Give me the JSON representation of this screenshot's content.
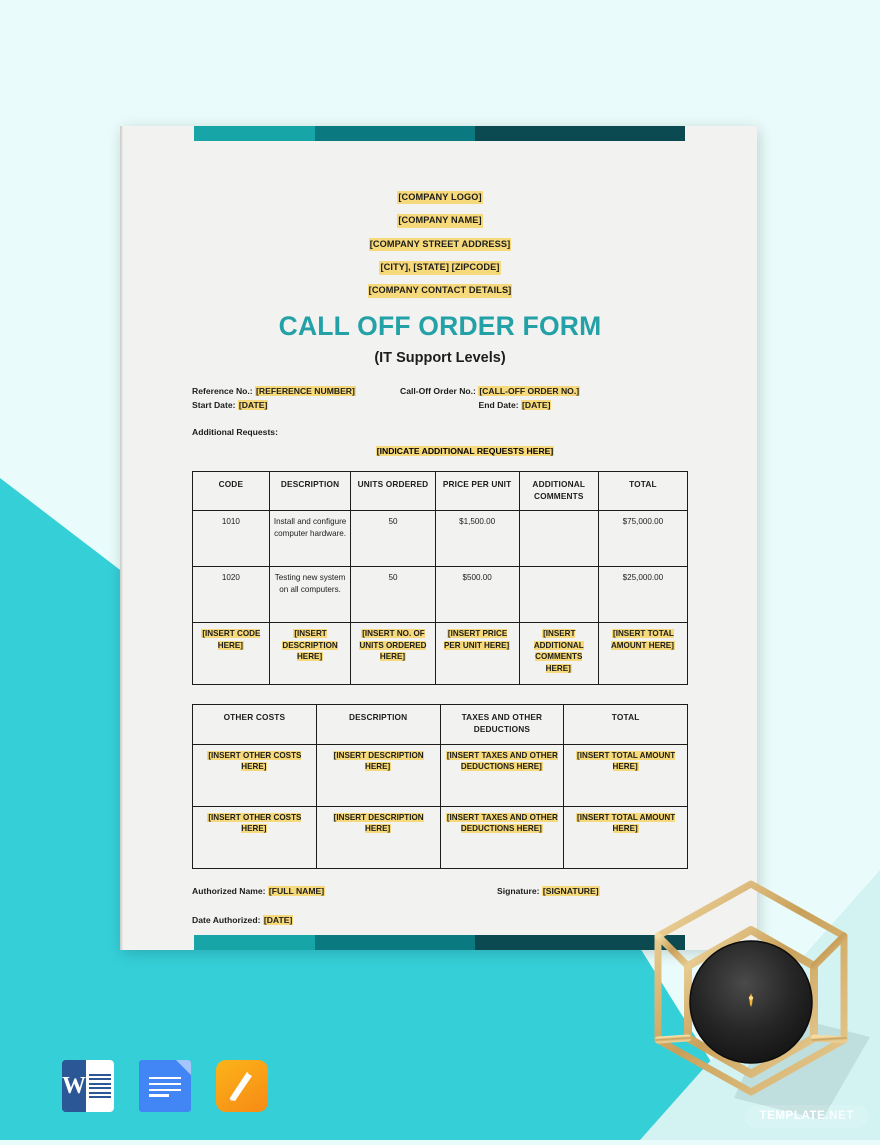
{
  "background": {
    "pale_teal": "#e9fcfb",
    "cyan": "#35cfd8",
    "page": "#f2f2f1"
  },
  "page": {
    "band_colors": [
      "#17a5a8",
      "#0b7a80",
      "#0b4a51"
    ],
    "company": [
      "[COMPANY LOGO]",
      "[COMPANY NAME]",
      "[COMPANY STREET ADDRESS]",
      "[CITY], [STATE] [ZIPCODE]",
      "[COMPANY CONTACT DETAILS]"
    ],
    "title": "CALL OFF ORDER FORM",
    "title_color": "#23a1a6",
    "subtitle": "(IT Support Levels)",
    "highlight_color": "#f6d97a",
    "meta": {
      "reference_label": "Reference No.: ",
      "reference_value": "[REFERENCE NUMBER]",
      "calloff_label": "Call-Off Order No.: ",
      "calloff_value": "[CALL-OFF ORDER NO.]",
      "start_label": "Start Date: ",
      "start_value": "[DATE]",
      "end_label": "End Date: ",
      "end_value": "[DATE]",
      "additional_label": "Additional Requests:",
      "additional_value": "[INDICATE ADDITIONAL REQUESTS HERE]"
    },
    "order_table": {
      "headers": [
        "CODE",
        "DESCRIPTION",
        "UNITS ORDERED",
        "PRICE PER UNIT",
        "ADDITIONAL COMMENTS",
        "TOTAL"
      ],
      "rows": [
        {
          "code": "1010",
          "description": "Install and configure computer hardware.",
          "units": "50",
          "price": "$1,500.00",
          "comments": "",
          "total": "$75,000.00",
          "highlight": false
        },
        {
          "code": "1020",
          "description": "Testing new system on all computers.",
          "units": "50",
          "price": "$500.00",
          "comments": "",
          "total": "$25,000.00",
          "highlight": false
        },
        {
          "code": "[INSERT CODE HERE]",
          "description": "[INSERT DESCRIPTION HERE]",
          "units": "[INSERT NO. OF UNITS ORDERED HERE]",
          "price": "[INSERT PRICE PER UNIT HERE]",
          "comments": "[INSERT ADDITIONAL COMMENTS HERE]",
          "total": "[INSERT TOTAL AMOUNT HERE]",
          "highlight": true
        }
      ]
    },
    "costs_table": {
      "headers": [
        "OTHER COSTS",
        "DESCRIPTION",
        "TAXES AND OTHER DEDUCTIONS",
        "TOTAL"
      ],
      "rows": [
        {
          "other_costs": "[INSERT OTHER COSTS HERE]",
          "description": "[INSERT DESCRIPTION HERE]",
          "taxes": "[INSERT TAXES AND OTHER DEDUCTIONS HERE]",
          "total": "[INSERT TOTAL AMOUNT HERE]"
        },
        {
          "other_costs": "[INSERT OTHER COSTS HERE]",
          "description": "[INSERT DESCRIPTION HERE]",
          "taxes": "[INSERT TAXES AND OTHER DEDUCTIONS HERE]",
          "total": "[INSERT TOTAL AMOUNT HERE]"
        }
      ]
    },
    "footer": {
      "authorized_label": "Authorized Name: ",
      "authorized_value": "[FULL NAME]",
      "signature_label": "Signature: ",
      "signature_value": "[SIGNATURE]",
      "date_label": "Date Authorized: ",
      "date_value": "[DATE]"
    }
  },
  "app_icons": [
    {
      "name": "microsoft-word-icon",
      "label": "W"
    },
    {
      "name": "google-docs-icon",
      "label": ""
    },
    {
      "name": "apple-pages-icon",
      "label": ""
    }
  ],
  "watermark": {
    "primary": "TEMPLATE",
    "suffix": ".NET"
  }
}
